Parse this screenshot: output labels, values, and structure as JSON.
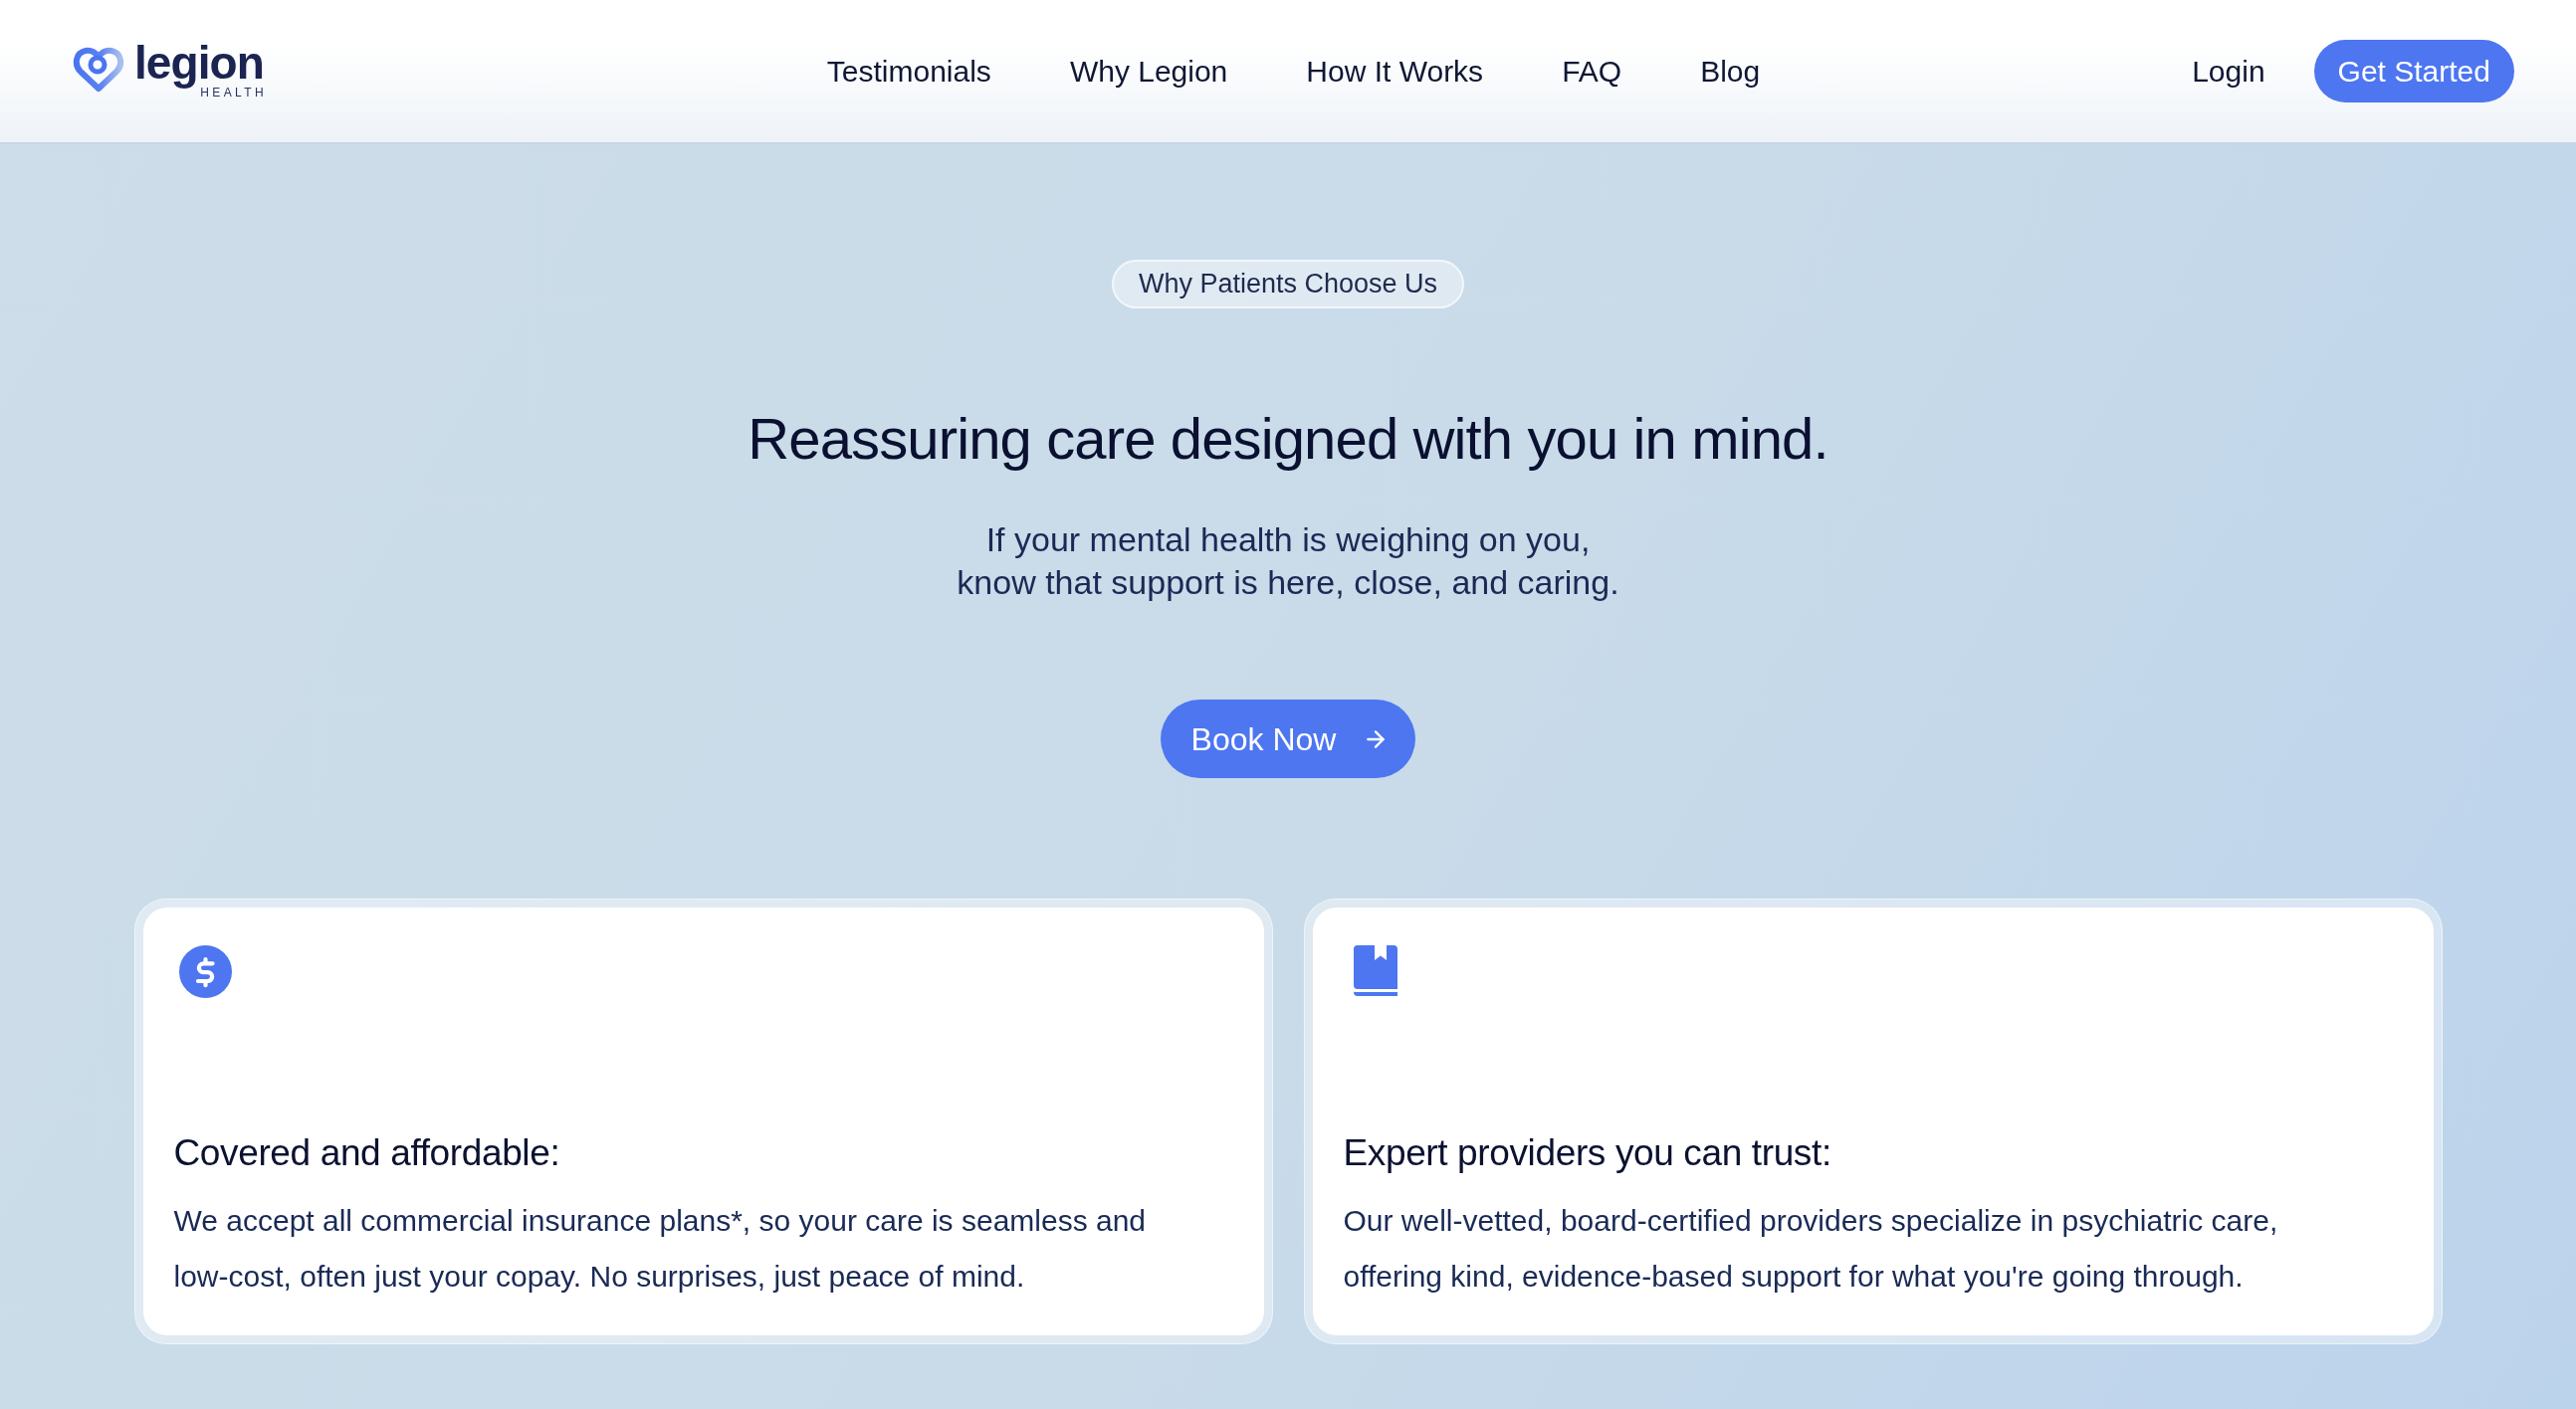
{
  "header": {
    "logo": {
      "wordmark": "legion",
      "tagline": "HEALTH"
    },
    "nav": [
      "Testimonials",
      "Why Legion",
      "How It Works",
      "FAQ",
      "Blog"
    ],
    "login": "Login",
    "cta": "Get Started"
  },
  "hero": {
    "tag": "Why Patients Choose Us",
    "heading": "Reassuring care designed with you in mind.",
    "subtitle": [
      "If your mental health is weighing on you,",
      "know that support is here, close, and caring."
    ],
    "button": "Book Now"
  },
  "features": [
    {
      "kind": "dollar",
      "title": "Covered and affordable:",
      "body": "We accept all commercial insurance plans*, so your care is seamless and low-cost, often just your copay. No surprises, just peace of mind."
    },
    {
      "kind": "book",
      "title": "Expert providers you can trust:",
      "body": "Our well-vetted, board-certified providers specialize in psychiatric care, offering kind, evidence-based support for what you're going through."
    }
  ]
}
